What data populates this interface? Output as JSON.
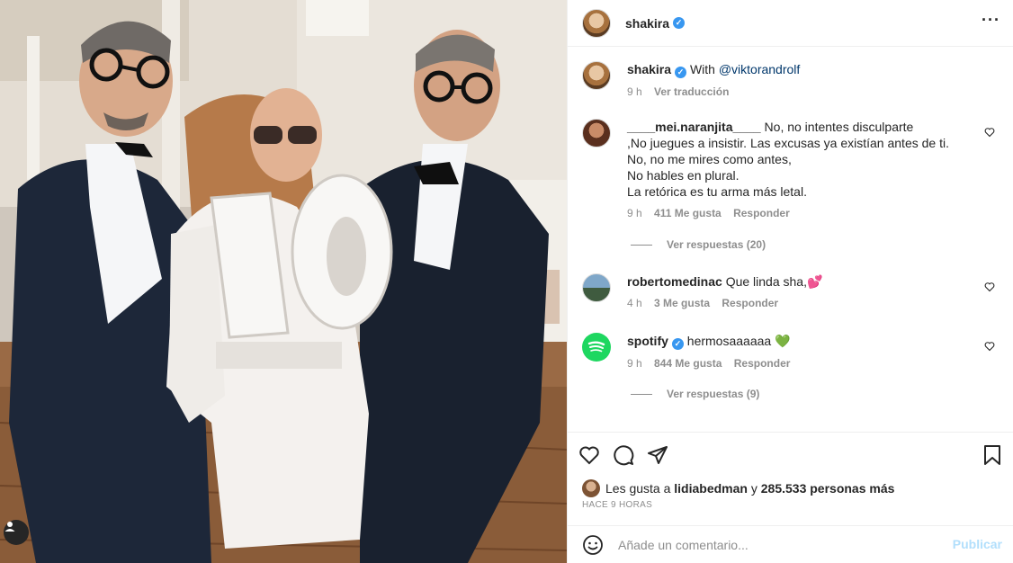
{
  "post": {
    "author": "shakira",
    "more_icon": "more-horizontal-icon"
  },
  "caption": {
    "author": "shakira",
    "with_label": "With",
    "mention": "@viktorandrolf",
    "age": "9 h",
    "translate": "Ver traducción"
  },
  "comments": [
    {
      "author": "____mei.naranjita____",
      "lines": [
        "No, no intentes disculparte",
        ",No juegues a insistir. Las excusas ya existían antes de ti.",
        "No, no me mires como antes,",
        "No hables en plural.",
        "La retórica es tu arma más letal."
      ],
      "age": "9 h",
      "likes": "411 Me gusta",
      "reply": "Responder",
      "view_replies": "Ver respuestas (20)"
    },
    {
      "author": "robertomedinac",
      "text": "Que linda sha,💕",
      "age": "4 h",
      "likes": "3 Me gusta",
      "reply": "Responder"
    },
    {
      "author": "spotify",
      "text": "hermosaaaaaa 💚",
      "age": "9 h",
      "likes": "844 Me gusta",
      "reply": "Responder",
      "view_replies": "Ver respuestas (9)"
    }
  ],
  "likes_line": {
    "prefix": "Les gusta a",
    "user": "lidiabedman",
    "conj": "y",
    "others": "285.533 personas más"
  },
  "timestamp": "HACE 9 HORAS",
  "composer": {
    "placeholder": "Añade un comentario...",
    "publish": "Publicar"
  },
  "colors": {
    "verified": "#3897f0",
    "link": "#00376b",
    "muted": "#8e8e8e",
    "publish_disabled": "#b2dffc",
    "spotify": "#1ed760"
  }
}
